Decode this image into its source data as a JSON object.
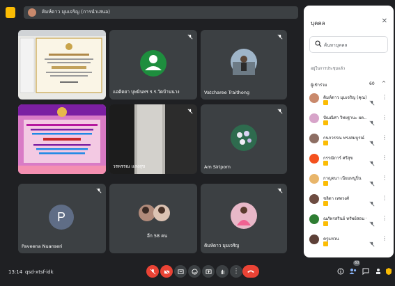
{
  "top": {
    "presenter_text": "คิมห์ดาว มุมเจริญ (การนำเสนอ)"
  },
  "tiles": [
    {
      "name": ""
    },
    {
      "name": "แอดิดยา บุษมินทร ร.ร.วัดบ้านนาง"
    },
    {
      "name": "Vatcharee Traithong"
    },
    {
      "name": ""
    },
    {
      "name": "วรพรรณ แสงสุข"
    },
    {
      "name": "Am Siriporn"
    },
    {
      "name": "Paveena Nuanseri",
      "initial": "P"
    },
    {
      "name": "อีก 58 คน"
    },
    {
      "name": "คิมห์ดาว มุมเจริญ"
    }
  ],
  "panel": {
    "title": "บุคคล",
    "search_placeholder": "ค้นหาบุคคล",
    "section_label": "อยู่ในการประชุมแล้ว",
    "group_label": "ผู้เข้าร่วม",
    "group_count": "60",
    "participants": [
      {
        "name": "คิมห์ดาว มุมเจริญ (คุณ)",
        "color": "#c9896c"
      },
      {
        "name": "ปัณณิศา วิทยฐานะ ผต...",
        "color": "#d7a4c9"
      },
      {
        "name": "กนกวรรณ ทรงสมบูรณ์",
        "color": "#8d6e63"
      },
      {
        "name": "กรรณิการ์ ศรีสุข",
        "color": "#f4511e"
      },
      {
        "name": "กาญจนา เนียมหนูปิ่น",
        "color": "#e8b56a"
      },
      {
        "name": "ชลิดา เทพวงศ์",
        "color": "#6d4c41"
      },
      {
        "name": "ณภัทรสรินย์ ทรัพย์สอน ร.ร.บ...",
        "color": "#2e7d32"
      },
      {
        "name": "ครูแหวน",
        "color": "#5d4037"
      }
    ]
  },
  "bottom": {
    "time": "13:14",
    "meeting_code": "qsd-xtsf-idk",
    "people_count": "60"
  }
}
